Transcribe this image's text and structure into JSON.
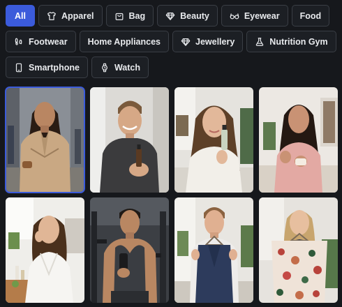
{
  "filters": {
    "all": "All",
    "apparel": "Apparel",
    "bag": "Bag",
    "beauty": "Beauty",
    "eyewear": "Eyewear",
    "food": "Food",
    "footwear": "Footwear",
    "home_appliances": "Home Appliances",
    "jewellery": "Jewellery",
    "nutrition_gym": "Nutrition Gym",
    "smartphone": "Smartphone",
    "watch": "Watch",
    "active": "All",
    "accent_color": "#3b5bdb"
  },
  "gallery": {
    "selected_index": 0,
    "items": [
      {
        "id": "model-trench-coat-street",
        "icon": "photo-woman-trench-coat"
      },
      {
        "id": "model-man-serum-bottle",
        "icon": "photo-man-serum"
      },
      {
        "id": "model-woman-serum-dropper",
        "icon": "photo-woman-serum"
      },
      {
        "id": "model-woman-cream-jar",
        "icon": "photo-woman-cream"
      },
      {
        "id": "model-woman-bathrobe-skincare",
        "icon": "photo-woman-bathrobe"
      },
      {
        "id": "model-man-gym-shaker",
        "icon": "photo-man-gym"
      },
      {
        "id": "model-man-blazer-hanger",
        "icon": "photo-man-blazer"
      },
      {
        "id": "model-woman-floral-shirt",
        "icon": "photo-woman-floral"
      }
    ]
  }
}
